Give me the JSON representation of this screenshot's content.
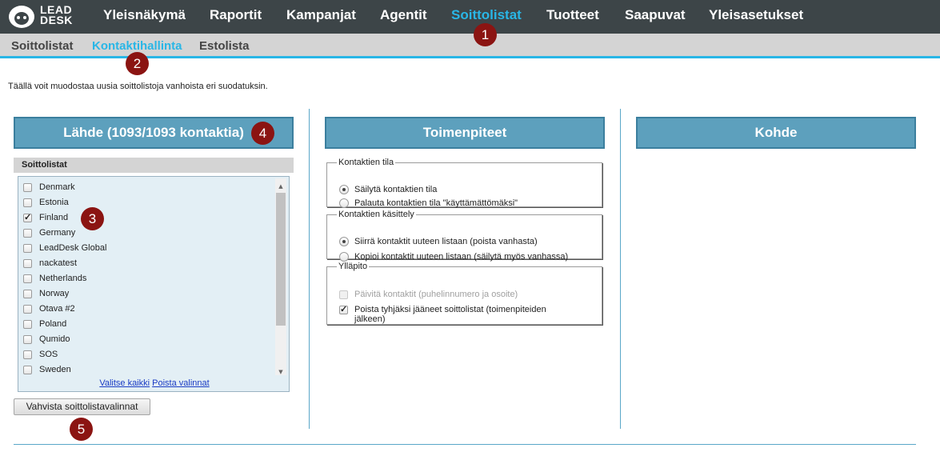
{
  "app": {
    "logo_text_line1": "LEAD",
    "logo_text_line2": "DESK"
  },
  "nav": {
    "items": [
      {
        "label": "Yleisnäkymä"
      },
      {
        "label": "Raportit"
      },
      {
        "label": "Kampanjat"
      },
      {
        "label": "Agentit"
      },
      {
        "label": "Soittolistat",
        "active": true
      },
      {
        "label": "Tuotteet"
      },
      {
        "label": "Saapuvat"
      },
      {
        "label": "Yleisasetukset"
      }
    ]
  },
  "subnav": {
    "items": [
      {
        "label": "Soittolistat"
      },
      {
        "label": "Kontaktihallinta",
        "active": true
      },
      {
        "label": "Estolista"
      }
    ]
  },
  "badges": [
    "1",
    "2",
    "3",
    "4",
    "5"
  ],
  "intro": "Täällä voit muodostaa uusia soittolistoja vanhoista eri suodatuksin.",
  "source": {
    "title": "Lähde (1093/1093 kontaktia)",
    "list_label": "Soittolistat",
    "items": [
      {
        "label": "Denmark",
        "checked": false
      },
      {
        "label": "Estonia",
        "checked": false
      },
      {
        "label": "Finland",
        "checked": true
      },
      {
        "label": "Germany",
        "checked": false
      },
      {
        "label": "LeadDesk Global",
        "checked": false
      },
      {
        "label": "nackatest",
        "checked": false
      },
      {
        "label": "Netherlands",
        "checked": false
      },
      {
        "label": "Norway",
        "checked": false
      },
      {
        "label": "Otava #2",
        "checked": false
      },
      {
        "label": "Poland",
        "checked": false
      },
      {
        "label": "Qumido",
        "checked": false
      },
      {
        "label": "SOS",
        "checked": false
      },
      {
        "label": "Sweden",
        "checked": false
      }
    ],
    "select_all": "Valitse kaikki",
    "clear_selection": "Poista valinnat",
    "confirm_button": "Vahvista soittolistavalinnat"
  },
  "actions": {
    "title": "Toimenpiteet",
    "groups": [
      {
        "legend": "Kontaktien tila",
        "options": [
          {
            "label": "Säilytä kontaktien tila",
            "selected": true
          },
          {
            "label": "Palauta kontaktien tila \"käyttämättömäksi\"",
            "selected": false
          }
        ]
      },
      {
        "legend": "Kontaktien käsittely",
        "options": [
          {
            "label": "Siirrä kontaktit uuteen listaan (poista vanhasta)",
            "selected": true
          },
          {
            "label": "Kopioi kontaktit uuteen listaan (säilytä myös vanhassa)",
            "selected": false
          }
        ]
      },
      {
        "legend": "Ylläpito",
        "checks": [
          {
            "label": "Päivitä kontaktit (puhelinnumero ja osoite)",
            "checked": false,
            "disabled": true
          },
          {
            "label_line1": "Poista tyhjäksi jääneet soittolistat (toimenpiteiden",
            "label_line2": "jälkeen)",
            "checked": true,
            "disabled": false
          }
        ]
      }
    ]
  },
  "target": {
    "title": "Kohde"
  },
  "colors": {
    "accent": "#29b6e6",
    "topbar": "#3d4548",
    "panel_header": "#5da0bd",
    "badge": "#8b1412",
    "list_bg": "#e3eff5"
  }
}
